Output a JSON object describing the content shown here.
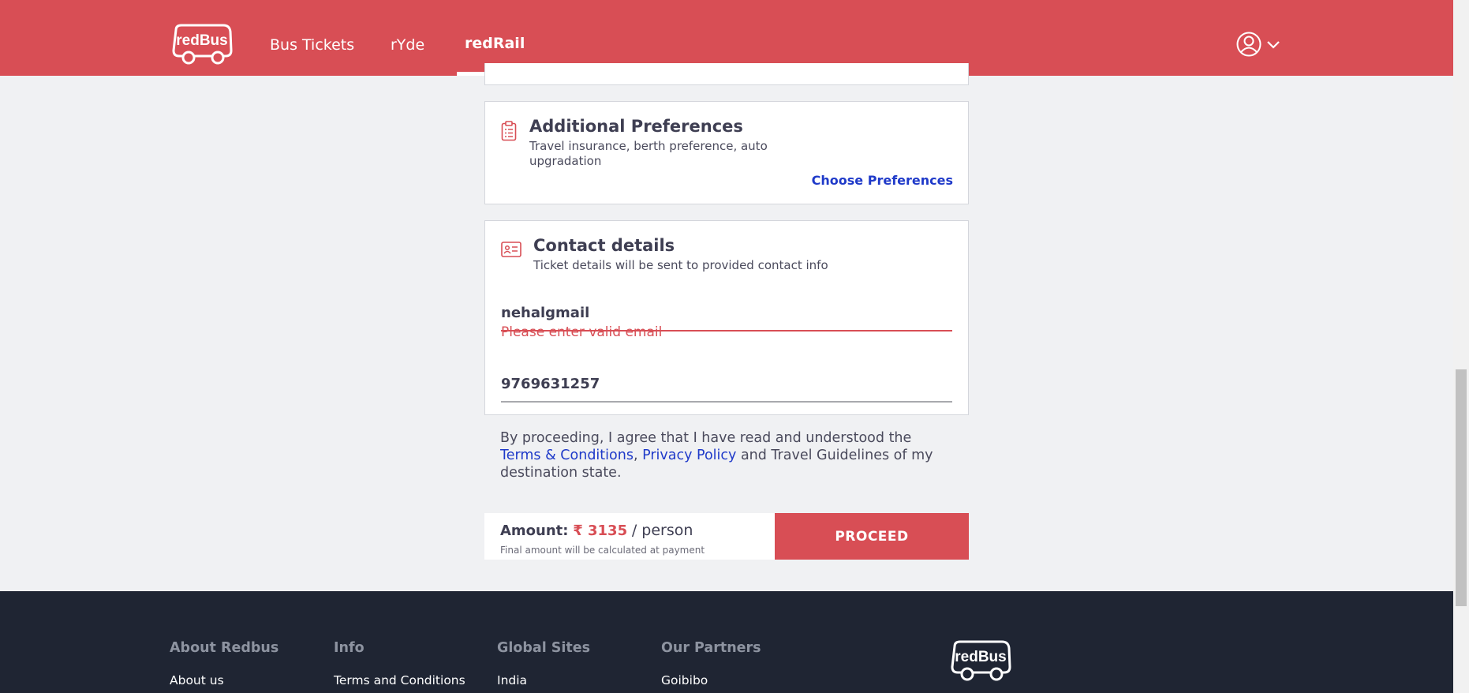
{
  "header": {
    "logo_text": "redBus",
    "nav": [
      {
        "label": "Bus Tickets"
      },
      {
        "label": "rYde"
      },
      {
        "label": "redRail"
      }
    ],
    "active_nav": "redRail",
    "user_icon": "user-circle-icon",
    "user_chevron_icon": "chevron-down-icon"
  },
  "preferences": {
    "icon": "clipboard-icon",
    "title": "Additional Preferences",
    "subtitle_line1": "Travel insurance, berth preference, auto",
    "subtitle_line2": "upgradation",
    "link": "Choose Preferences"
  },
  "contact": {
    "icon": "id-card-icon",
    "title": "Contact details",
    "subtitle": "Ticket details will be sent to provided contact info",
    "email_value": "nehalgmail",
    "email_error": "Please enter valid email",
    "phone_value": "9769631257"
  },
  "agreement": {
    "line1": "By proceeding, I agree that I have read and understood the",
    "terms_link": "Terms & Conditions",
    "comma": ",",
    "privacy_link": "Privacy Policy",
    "line2_rest": "and Travel Guidelines of my",
    "line3": "destination state."
  },
  "payment": {
    "amount_label": "Amount:",
    "amount_value": "₹ 3135",
    "amount_unit": "/ person",
    "note": "Final amount will be calculated at payment",
    "proceed_label": "PROCEED"
  },
  "footer": {
    "columns": [
      {
        "heading": "About Redbus",
        "first_link": "About us"
      },
      {
        "heading": "Info",
        "first_link": "Terms and Conditions"
      },
      {
        "heading": "Global Sites",
        "first_link": "India"
      },
      {
        "heading": "Our Partners",
        "first_link": "Goibibo"
      }
    ],
    "logo_text": "redBus"
  },
  "colors": {
    "brand": "#d84e55",
    "link": "#1f3ac9",
    "footer_bg": "#1f2533",
    "page_bg": "#f0f1f3"
  }
}
